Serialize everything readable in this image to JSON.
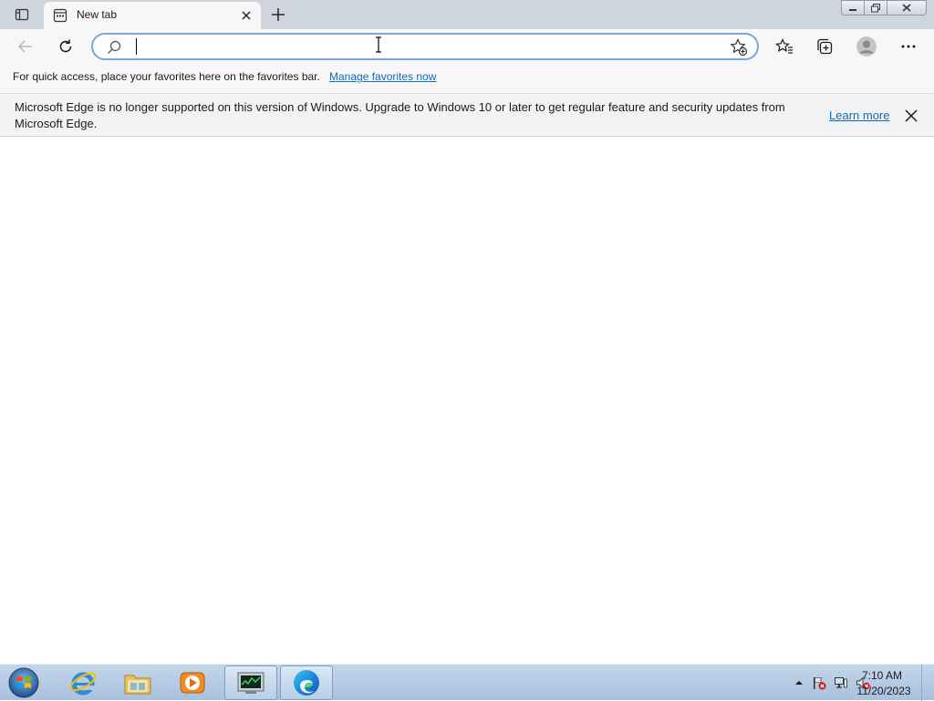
{
  "tab": {
    "title": "New tab"
  },
  "addressbar": {
    "value": "",
    "placeholder": ""
  },
  "favorites_bar": {
    "message": "For quick access, place your favorites here on the favorites bar.",
    "link": "Manage favorites now"
  },
  "infobar": {
    "message": "Microsoft Edge is no longer supported on this version of Windows. Upgrade to Windows 10 or later to get regular feature and security updates from Microsoft Edge.",
    "link": "Learn more"
  },
  "taskbar": {
    "apps": [
      "internet-explorer",
      "windows-explorer",
      "media-player",
      "task-manager",
      "microsoft-edge"
    ],
    "active_app": "microsoft-edge"
  },
  "clock": {
    "time": "7:10 AM",
    "date": "11/20/2023"
  },
  "colors": {
    "accent": "#0f6cbd",
    "address_border": "#7aa7d8",
    "tabstrip": "#cfd5dc",
    "taskbar": "#b3c9e2"
  }
}
